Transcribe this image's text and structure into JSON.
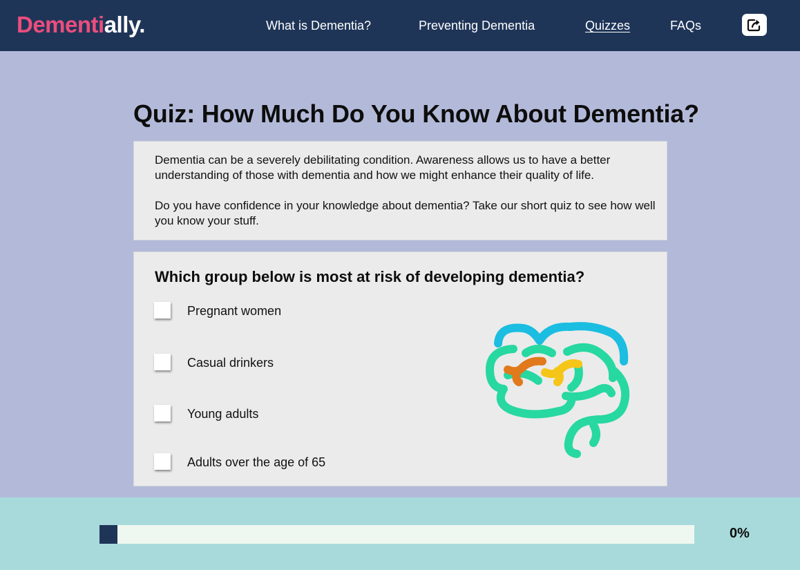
{
  "brand": {
    "name_part1": "Dementi",
    "name_part2": "ally."
  },
  "nav": {
    "items": [
      {
        "label": "What is Dementia?"
      },
      {
        "label": "Preventing Dementia"
      },
      {
        "label": "Quizzes",
        "active": true
      },
      {
        "label": "FAQs"
      }
    ],
    "share_icon": "share-icon"
  },
  "main": {
    "title": "Quiz: How Much Do You Know About Dementia?",
    "intro": {
      "p1": "Dementia can be a severely debilitating condition.  Awareness allows us to have a better understanding of those with dementia and how we might enhance their quality of life.",
      "p2": "Do you have confidence in your knowledge about dementia? Take our short quiz to see how well you know your stuff."
    }
  },
  "quiz": {
    "question": "Which group below is most at risk of developing dementia?",
    "options": [
      {
        "label": "Pregnant women",
        "checked": false
      },
      {
        "label": "Casual drinkers",
        "checked": false
      },
      {
        "label": "Young adults",
        "checked": false
      },
      {
        "label": "Adults over the age  of 65",
        "checked": false
      }
    ],
    "illustration": "brain-icon"
  },
  "progress": {
    "value": 0,
    "label": "0%"
  },
  "colors": {
    "navbar": "#1f3558",
    "brand_pink": "#ec4d7d",
    "page_bg": "#b3bad9",
    "card_bg": "#ebebeb",
    "footer_bg": "#a8dadb",
    "progress_track": "#eff8f0",
    "progress_fill": "#1f3558",
    "brain_blue": "#1bbde0",
    "brain_green": "#27d8a0",
    "brain_orange": "#e07a1c",
    "brain_yellow": "#f5c518"
  }
}
